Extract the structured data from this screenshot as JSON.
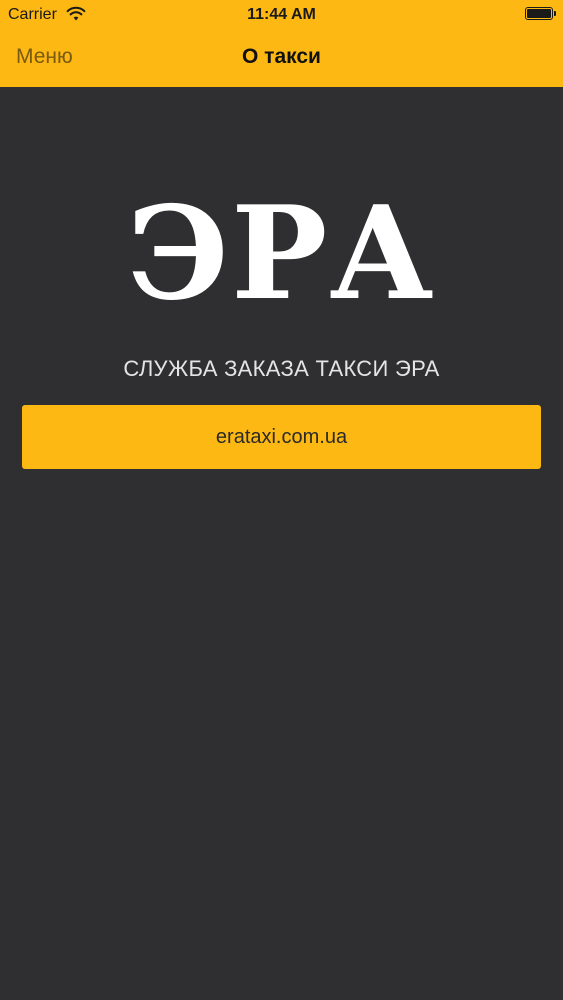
{
  "status_bar": {
    "carrier": "Carrier",
    "time": "11:44 AM",
    "wifi_icon": "wifi-icon",
    "battery_icon": "battery-icon"
  },
  "nav": {
    "menu_label": "Меню",
    "title": "О такси"
  },
  "content": {
    "logo_text": "ЭРА",
    "subtitle": "СЛУЖБА ЗАКАЗА ТАКСИ ЭРА",
    "website_label": "erataxi.com.ua"
  },
  "colors": {
    "accent": "#fdb813",
    "background": "#2f2f31",
    "logo": "#ffffff",
    "subtitle": "#e4e4e4"
  }
}
